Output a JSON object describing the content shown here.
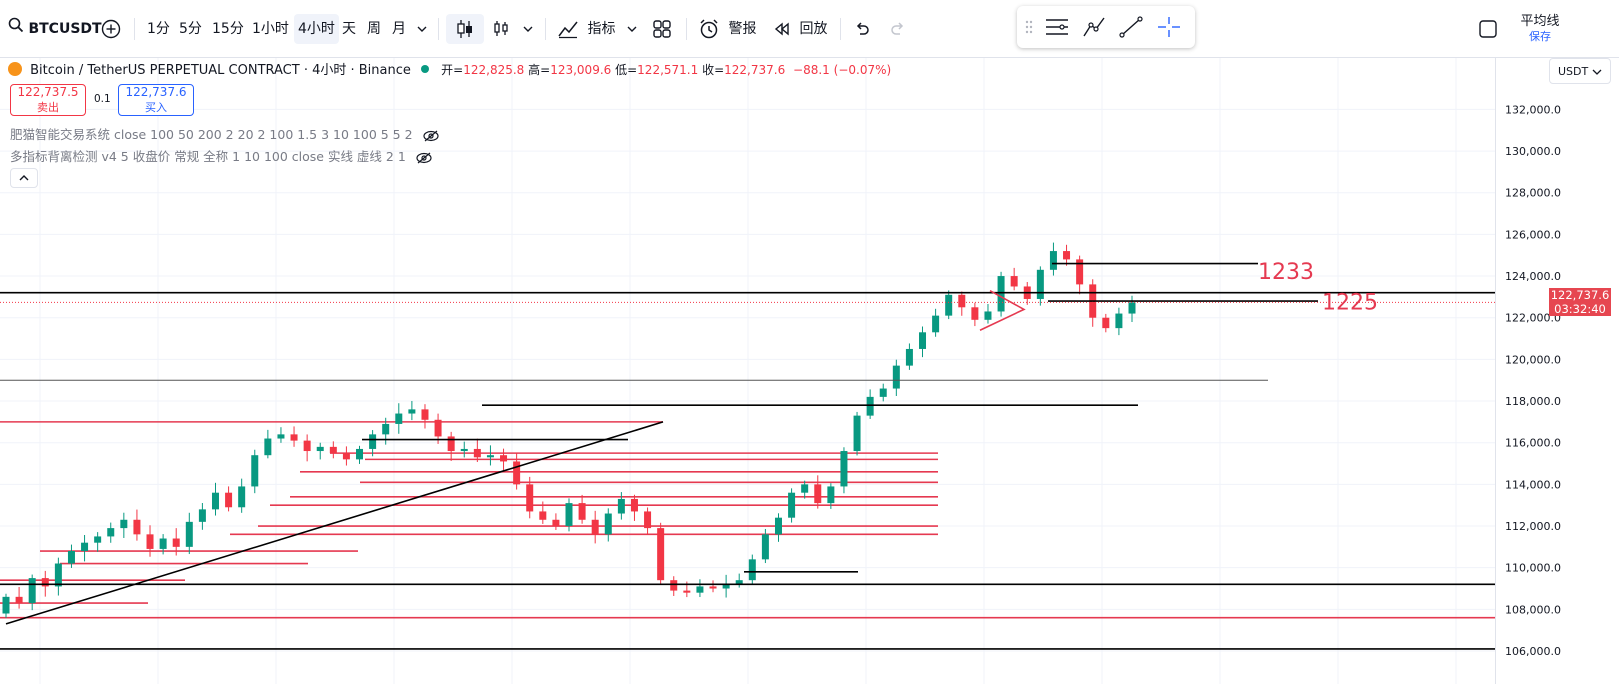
{
  "toolbar": {
    "symbol": "BTCUSDT",
    "intervals": [
      "1分",
      "5分",
      "15分",
      "1小时",
      "4小时",
      "天",
      "周",
      "月"
    ],
    "active_interval": "4小时",
    "indicators_label": "指标",
    "alert_label": "警报",
    "replay_label": "回放",
    "right_label": "平均线",
    "save_label": "保存"
  },
  "legend": {
    "pair": "Bitcoin / TetherUS PERPETUAL CONTRACT · 4小时 · Binance",
    "open_label": "开=",
    "open": "122,825.8",
    "high_label": "高=",
    "high": "123,009.6",
    "low_label": "低=",
    "low": "122,571.1",
    "close_label": "收=",
    "close": "122,737.6",
    "change": "−88.1 (−0.07%)"
  },
  "trade": {
    "sell_price": "122,737.5",
    "sell_label": "卖出",
    "spread": "0.1",
    "buy_price": "122,737.6",
    "buy_label": "买入"
  },
  "indicators": [
    "肥猫智能交易系统 close 100 50 200 2 20 2 100 1.5 3 10 100 5 5 2",
    "多指标背离检测 v4 5 收盘价 常规 全称 1 10 100 close 实线 虚线 2 1"
  ],
  "price_axis": {
    "currency": "USDT",
    "ticks": [
      "132,000.0",
      "130,000.0",
      "128,000.0",
      "126,000.0",
      "124,000.0",
      "122,000.0",
      "120,000.0",
      "118,000.0",
      "116,000.0",
      "114,000.0",
      "112,000.0",
      "110,000.0",
      "108,000.0",
      "106,000.0"
    ],
    "last_price": "122,737.6",
    "countdown": "03:32:40"
  },
  "annotations": [
    "1233",
    "1225"
  ],
  "colors": {
    "up": "#089981",
    "down": "#f23645",
    "level_red": "#e53950",
    "level_black": "#000000",
    "accent": "#2962ff"
  },
  "chart_data": {
    "type": "candlestick",
    "ylim": [
      105800,
      133000
    ],
    "ylabel": "USDT",
    "candles_close": [
      108600,
      108300,
      109500,
      109100,
      110200,
      110800,
      111200,
      111500,
      111900,
      112300,
      111600,
      110900,
      111400,
      111000,
      112200,
      112800,
      113600,
      112900,
      113900,
      115400,
      116200,
      116400,
      116100,
      115600,
      115800,
      115500,
      115200,
      115700,
      116400,
      116900,
      117400,
      117600,
      117100,
      116300,
      115600,
      115700,
      115300,
      115400,
      115100,
      114000,
      112700,
      112300,
      112000,
      113100,
      112300,
      111600,
      112600,
      113300,
      112700,
      111900,
      109400,
      108900,
      108800,
      109100,
      109000,
      109200,
      109400,
      110400,
      111600,
      112400,
      113600,
      114000,
      113100,
      113900,
      115600,
      117300,
      118200,
      118600,
      119700,
      120500,
      121300,
      122100,
      123100,
      122500,
      121900,
      122300,
      124000,
      123500,
      122900,
      124300,
      125200,
      124800,
      123600,
      122000,
      121500,
      122200,
      122737.6
    ],
    "levels_black": [
      124600,
      123200,
      122800,
      119000,
      117800,
      109800,
      109200,
      106100
    ],
    "levels_red": [
      117000,
      115500,
      115200,
      114600,
      114100,
      113400,
      113000,
      112000,
      111600,
      110800,
      110200,
      109400,
      108300,
      107600
    ]
  }
}
